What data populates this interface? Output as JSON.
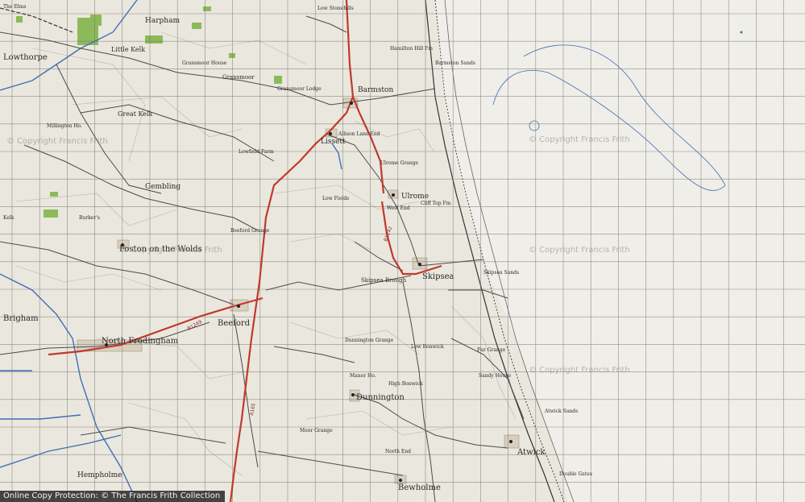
{
  "map": {
    "places": {
      "lowthorpe": "Lowthorpe",
      "little_kelk": "Little Kelk",
      "harpham": "Harpham",
      "great_kelk": "Great Kelk",
      "barmston": "Barmston",
      "lissett": "Lissett",
      "gransmoor": "Gransmoor",
      "ulrome": "Ulrome",
      "gembling": "Gembling",
      "foston": "Foston on the Wolds",
      "brigham": "Brigham",
      "north_frodingham": "North Frodingham",
      "beeford": "Beeford",
      "skipsea": "Skipsea",
      "dunnington": "Dunnington",
      "atwick": "Atwick",
      "bewholme": "Bewholme",
      "hempholme": "Hempholme",
      "brough": "Skipsea Brough"
    },
    "minor": {
      "elms": "The Elms",
      "stonehills": "Low Stonehills",
      "hamilton": "Hamilton Hill Fm",
      "gransmoor_ho": "Gransmoor House",
      "gransmoor_lodge": "Gransmoor Lodge",
      "allison_lane": "Allison Lane End",
      "ulrome_grange": "Ulrome Grange",
      "west_end": "West End",
      "cliff_top": "Cliff Top Fm",
      "low_fields": "Low Fields",
      "beeford_grange": "Beeford Grange",
      "lowfield": "Lowfield Farm",
      "dunnington_grange": "Dunnington Grange",
      "manor_ho": "Manor Ho.",
      "high_bonwick": "High Bonwick",
      "low_bonwick": "Low Bonwick",
      "fur_grange": "Fur Grange",
      "north_end": "North End",
      "moor_grange": "Moor Grange",
      "millington": "Millington Ho.",
      "barmston_sands": "Barmston Sands",
      "skipsea_sands": "Skipsea Sands",
      "atwick_sands": "Atwick Sands",
      "double_gates": "Double Gates",
      "burkers": "Burker's",
      "kelk": "Kelk",
      "sandy_house": "Sandy House"
    },
    "roads": {
      "a165": "A165",
      "b1249": "B1249",
      "b1242": "B1242"
    },
    "colors": {
      "paper": "#eae7de",
      "grid": "#6e6e6e",
      "road": "#c0392b",
      "water": "#3f6fb5",
      "woods": "#7cb342",
      "coast": "#444444"
    }
  },
  "watermark": "© Copyright Francis Frith",
  "footer": "Online Copy Protection: © The Francis Frith Collection"
}
